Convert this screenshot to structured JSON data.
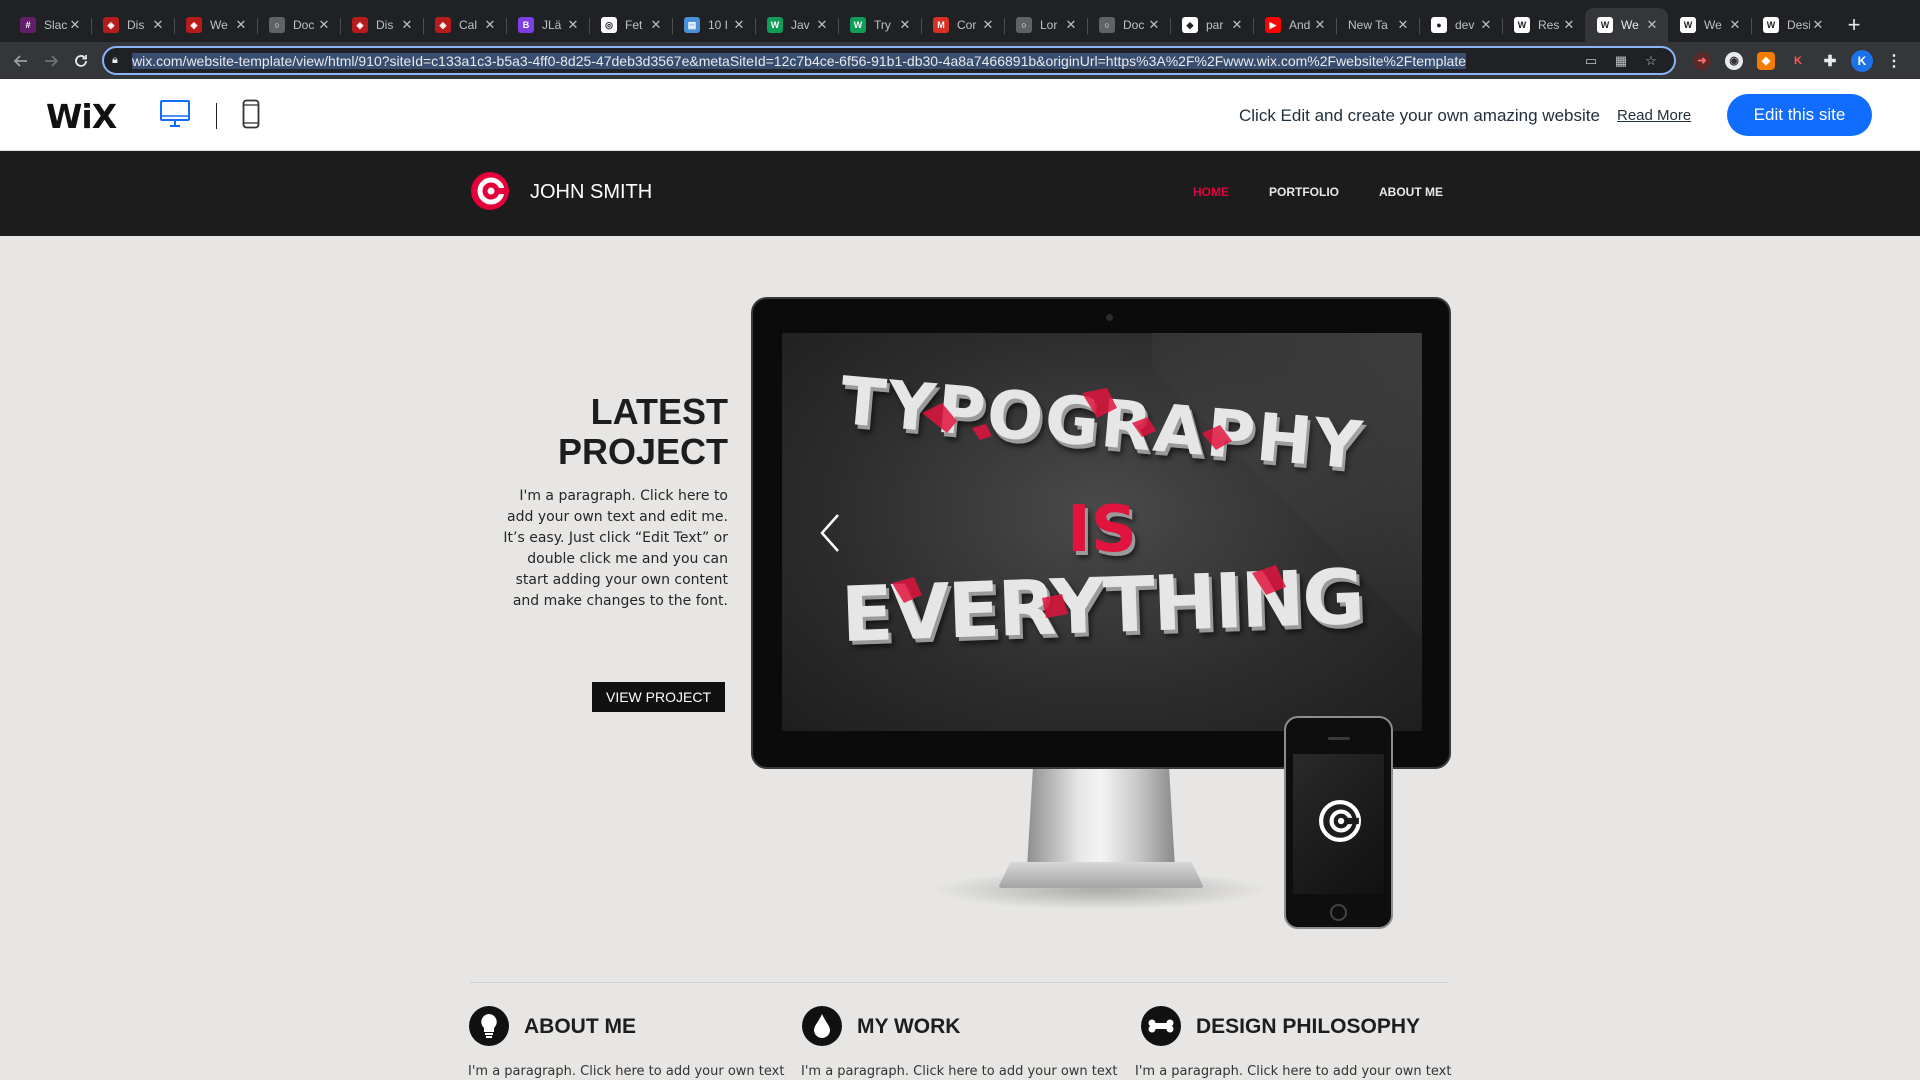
{
  "browser": {
    "tabs": [
      {
        "title": "Slack",
        "fav_color": "#611f69",
        "fav_glyph": "#"
      },
      {
        "title": "Dis",
        "fav_color": "#b71c1c",
        "fav_glyph": "◈"
      },
      {
        "title": "We",
        "fav_color": "#b71c1c",
        "fav_glyph": "◈"
      },
      {
        "title": "Doc",
        "fav_color": "#5f6368",
        "fav_glyph": "○"
      },
      {
        "title": "Dis",
        "fav_color": "#b71c1c",
        "fav_glyph": "◈"
      },
      {
        "title": "Cal",
        "fav_color": "#b71c1c",
        "fav_glyph": "◈"
      },
      {
        "title": "JLä",
        "fav_color": "#7b3fe4",
        "fav_glyph": "B"
      },
      {
        "title": "Fet",
        "fav_color": "#ffffff",
        "fav_glyph": "◎"
      },
      {
        "title": "10 I",
        "fav_color": "#4a90d9",
        "fav_glyph": "▤"
      },
      {
        "title": "Jav",
        "fav_color": "#0f9d58",
        "fav_glyph": "W"
      },
      {
        "title": "Try",
        "fav_color": "#0f9d58",
        "fav_glyph": "W"
      },
      {
        "title": "Cor",
        "fav_color": "#d93025",
        "fav_glyph": "M"
      },
      {
        "title": "Lor",
        "fav_color": "#5f6368",
        "fav_glyph": "○"
      },
      {
        "title": "Doc",
        "fav_color": "#5f6368",
        "fav_glyph": "○"
      },
      {
        "title": "par",
        "fav_color": "#ffffff",
        "fav_glyph": "◆"
      },
      {
        "title": "And",
        "fav_color": "#ff0000",
        "fav_glyph": "▶"
      },
      {
        "title": "New Ta",
        "fav_color": "",
        "fav_glyph": ""
      },
      {
        "title": "dev",
        "fav_color": "#ffffff",
        "fav_glyph": "●"
      },
      {
        "title": "Res",
        "fav_color": "#ffffff",
        "fav_glyph": "W"
      },
      {
        "title": "We",
        "fav_color": "#ffffff",
        "fav_glyph": "W",
        "active": true
      },
      {
        "title": "We",
        "fav_color": "#ffffff",
        "fav_glyph": "W"
      },
      {
        "title": "Design",
        "fav_color": "#ffffff",
        "fav_glyph": "W"
      }
    ],
    "url": "wix.com/website-template/view/html/910?siteId=c133a1c3-b5a3-4ff0-8d25-47deb3d3567e&metaSiteId=12c7b4ce-6f56-91b1-db30-4a8a7466891b&originUrl=https%3A%2F%2Fwww.wix.com%2Fwebsite%2Ftemplate",
    "profile_initial": "K"
  },
  "wix": {
    "logo": "WiX",
    "message": "Click Edit and create your own amazing website",
    "read_more": "Read More",
    "edit_button": "Edit this site",
    "accent": "#116dff"
  },
  "site": {
    "name": "JOHN SMITH",
    "nav": [
      "HOME",
      "PORTFOLIO",
      "ABOUT ME"
    ],
    "accent": "#e4003a"
  },
  "hero": {
    "title_line1": "LATEST",
    "title_line2": "PROJECT",
    "paragraph": "I'm a paragraph. Click here to add your own text and edit me. It’s easy. Just click “Edit Text” or double click me and you can start adding your own content and make changes to the font.",
    "button": "VIEW PROJECT",
    "screen_text": [
      "TYPOGRAPHY",
      "IS",
      "EVERYTHING"
    ]
  },
  "features": [
    {
      "title": "ABOUT ME",
      "icon": "lightbulb-icon",
      "text": "I'm a paragraph. Click here to add your own text"
    },
    {
      "title": "MY WORK",
      "icon": "drop-icon",
      "text": "I'm a paragraph. Click here to add your own text"
    },
    {
      "title": "DESIGN PHILOSOPHY",
      "icon": "bone-icon",
      "text": "I'm a paragraph. Click here to add your own text"
    }
  ]
}
